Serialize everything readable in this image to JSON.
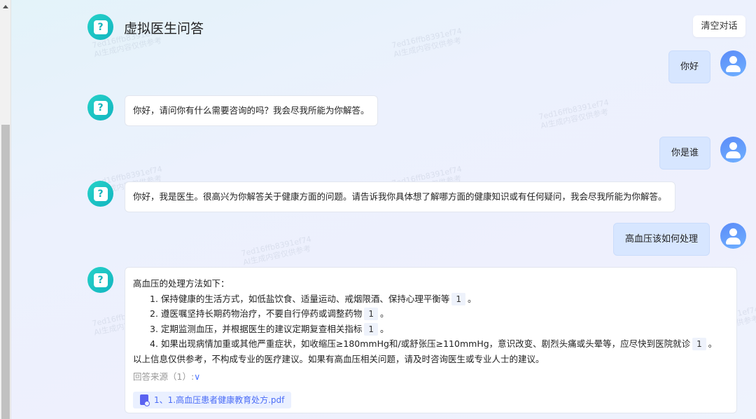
{
  "header": {
    "title": "虚拟医生问答",
    "clear_label": "清空对话"
  },
  "watermark": {
    "id": "7ed16ffb8391ef74",
    "text": "AI生成内容仅供参考"
  },
  "messages": [
    {
      "role": "user",
      "text": "你好"
    },
    {
      "role": "bot",
      "text": "你好，请问你有什么需要咨询的吗？我会尽我所能为你解答。"
    },
    {
      "role": "user",
      "text": "你是谁"
    },
    {
      "role": "bot",
      "text": "你好，我是医生。很高兴为你解答关于健康方面的问题。请告诉我你具体想了解哪方面的健康知识或有任何疑问，我会尽我所能为你解答。"
    },
    {
      "role": "user",
      "text": "高血压该如何处理"
    }
  ],
  "answer": {
    "intro": "高血压的处理方法如下：",
    "items": [
      {
        "text": "1. 保持健康的生活方式，如低盐饮食、适量运动、戒烟限酒、保持心理平衡等",
        "cite": "1"
      },
      {
        "text": "2. 遵医嘱坚持长期药物治疗，不要自行停药或调整药物",
        "cite": "1"
      },
      {
        "text": "3. 定期监测血压，并根据医生的建议定期复查相关指标",
        "cite": "1"
      },
      {
        "text": "4. 如果出现病情加重或其他严重症状，如收缩压≥180mmHg和/或舒张压≥110mmHg，意识改变、剧烈头痛或头晕等，应尽快到医院就诊",
        "cite": "1"
      }
    ],
    "period": "。",
    "disclaimer": "以上信息仅供参考，不构成专业的医疗建议。如果有高血压相关问题，请及时咨询医生或专业人士的建议。",
    "sources_label": "回答来源（1）:",
    "sources": [
      {
        "name": "1、1.高血压患者健康教育处方.pdf"
      }
    ]
  }
}
